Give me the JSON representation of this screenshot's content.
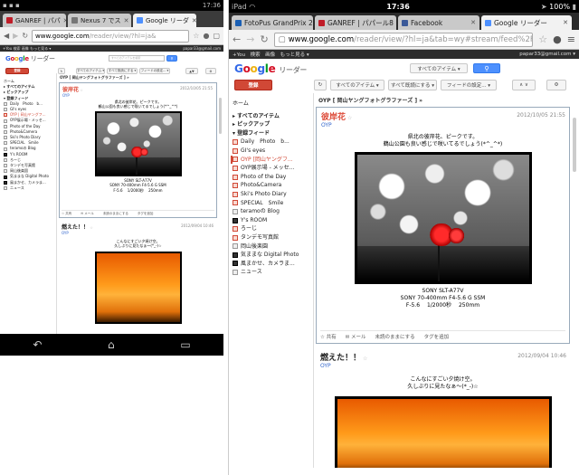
{
  "left": {
    "status": {
      "time": "17:36"
    },
    "tabs": [
      {
        "label": "GANREF | パパ"
      },
      {
        "label": "Nexus 7 でス"
      },
      {
        "label": "Google リーダ"
      }
    ],
    "url_domain": "www.google.com",
    "url_path": "/reader/view/?hl=ja&",
    "gbar": {
      "links": [
        "+You",
        "検索",
        "画像",
        "もっと見る ▾"
      ],
      "user": "papar33@gmail.com"
    },
    "logo_sub": "リーダー",
    "search_placeholder": "すべてのアイテムを検索",
    "buttons": {
      "subscribe": "登録",
      "all_items": "すべてのアイテム ▾",
      "mark_all": "すべて既読にする ▾",
      "feed_settings": "フィードの設定... ▾"
    },
    "nav": {
      "home": "ホーム",
      "all_items": "▸ すべてのアイテム",
      "pickup": "▸ ピックアップ",
      "subscriptions": "▾ 登録フィード",
      "feeds": [
        "Daily　Photo　b...",
        "GI's eyes",
        "OYP | 岡山ヤングフ...",
        "OYP展示場 - メッセ...",
        "Photo of the Day",
        "Photo&Camera",
        "Ski's Photo Diary",
        "SPECIAL　Smile",
        "teramoの Blog",
        "Y's ROOM",
        "ろーじ",
        "タンデモ写真館",
        "岡山後楽園",
        "気ままな Digital Photo",
        "風まかせ、カメラま...",
        "ニュース"
      ]
    },
    "feed_header": "OYP [ 岡山ヤングフォトグラファーズ ] »",
    "entry1": {
      "title": "彼岸花",
      "source": "OYP",
      "date": "2012/10/05 21:55",
      "caption_top": [
        "県北の彼岸花、ピークです。",
        "鶴山公園も良い感じで咲いてるでしょう(*^_^*)"
      ],
      "caption_bottom": [
        "SONY SLT-A77V",
        "SONY 70-400mm F4-5.6 G SSM",
        "F-5.6　 1/2000秒　 250mm"
      ]
    },
    "actions": [
      "☆ 共有",
      "✉ メール",
      "未読のままにする",
      "タグを追加"
    ],
    "entry2": {
      "title": "燃えた！！",
      "source": "OYP",
      "date": "2012/09/04 10:46",
      "caption_top": [
        "こんなにすごい夕焼け空。",
        "久しぶりに見たなぁ～(*_-)☆"
      ]
    }
  },
  "right": {
    "status": {
      "device": "iPad",
      "time": "17:36",
      "battery": "100%"
    },
    "tabs": [
      {
        "label": "FotoPus GrandPrix 20",
        "color": "#1a5fb4"
      },
      {
        "label": "GANREF | パパール8",
        "color": "#c01c28"
      },
      {
        "label": "Facebook",
        "color": "#3b5998"
      },
      {
        "label": "Google リーダー",
        "color": "#4d90fe"
      }
    ],
    "url_domain": "www.google.com",
    "url_path": "/reader/view/?hl=ja&tab=wy#stream/feed%2Fhttp%3A%2F",
    "gbar": {
      "links": [
        "+You",
        "検索",
        "画像",
        "もっと見る ▾"
      ],
      "user": "papar33@gmail.com ▾"
    },
    "logo_sub": "リーダー",
    "buttons": {
      "subscribe": "登録",
      "all_items": "すべてのアイテム ▾",
      "mark_all": "すべて既読にする ▾",
      "feed_settings": "フィードの設定... ▾"
    },
    "nav": {
      "home": "ホーム",
      "all_items": "▸ すべてのアイテム",
      "pickup": "▸ ピックアップ",
      "subscriptions": "▾ 登録フィード",
      "feeds": [
        "Daily　Photo　b...",
        "GI's eyes",
        "OYP [岡山ヤングフ...",
        "OYP展示場 - メッセ...",
        "Photo of the Day",
        "Photo&Camera",
        "Ski's Photo Diary",
        "SPECIAL　Smile",
        "teramoの Blog",
        "Y's ROOM",
        "ろーじ",
        "タンデモ写真館",
        "岡山後楽園",
        "気ままな Digital Photo",
        "風まかせ、カメラま...",
        "ニュース"
      ]
    },
    "feed_header": "OYP [ 岡山ヤングフォトグラファーズ ] »",
    "entry1": {
      "title": "彼岸花",
      "source": "OYP",
      "date": "2012/10/05 21:55",
      "caption_top": [
        "県北の彼岸花、ピークです。",
        "鶴山公園も良い感じで咲いてるでしょう(*^_^*)"
      ],
      "caption_bottom": [
        "SONY SLT-A77V",
        "SONY 70-400mm F4-5.6 G SSM",
        "F-5.6　 1/2000秒　 250mm"
      ]
    },
    "actions": [
      "☆ 共有",
      "✉ メール",
      "未読のままにする",
      "タグを追加"
    ],
    "entry2": {
      "title": "燃えた！！",
      "source": "OYP",
      "date": "2012/09/04 10:46",
      "caption_top": [
        "こんなにすごい夕焼け空。",
        "久しぶりに見たなぁ～(*_-)☆"
      ]
    }
  }
}
